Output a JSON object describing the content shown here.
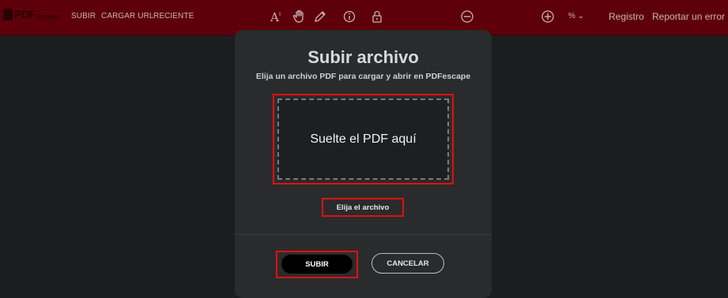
{
  "header": {
    "logo_text": "PDF",
    "logo_subtext": "escape",
    "nav": [
      "SUBIR",
      "CARGAR URL",
      "RECIENTE"
    ],
    "tools": [
      "text-tool-icon",
      "hand-tool-icon",
      "pencil-icon",
      "info-icon",
      "lock-icon"
    ],
    "zoom_out_icon": "minus-circle-icon",
    "zoom_in_icon": "plus-circle-icon",
    "zoom_dropdown": "%",
    "register": "Registro",
    "report_error": "Reportar un error"
  },
  "modal": {
    "title": "Subir archivo",
    "subtitle": "Elija un archivo PDF para cargar y abrir en PDFescape",
    "drop_text": "Suelte el PDF aquí",
    "choose_file": "Elija el archivo",
    "upload": "SUBIR",
    "cancel": "CANCELAR"
  },
  "colors": {
    "header_bg": "#5e0009",
    "highlight": "#e01010",
    "modal_bg": "#2a2b2d"
  }
}
